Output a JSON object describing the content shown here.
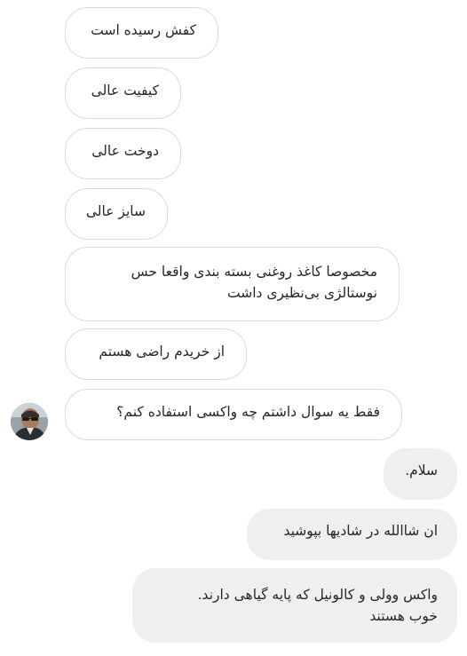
{
  "incoming_messages": [
    {
      "text": "کفش رسیده است"
    },
    {
      "text": "کیفیت عالی"
    },
    {
      "text": "دوخت عالی"
    },
    {
      "text": "سایز عالی"
    },
    {
      "line1": "مخصوصا کاغذ روغنی بسته بندی واقعا حس",
      "line2": "نوستالژی بی‌نظیری داشت"
    },
    {
      "text": "از خریدم راضی هستم"
    },
    {
      "text": "فقط یه سوال داشتم چه واکسی استفاده کنم؟"
    }
  ],
  "outgoing_messages": [
    {
      "text": "سلام."
    },
    {
      "text": "ان شاالله در شادیها بپوشید"
    },
    {
      "line1": "واکس وولی و کالونیل که پایه گیاهی دارند.",
      "line2": "خوب هستند"
    }
  ],
  "colors": {
    "incoming_bg": "#ffffff",
    "incoming_border": "#dbdbdb",
    "outgoing_bg": "#efefef",
    "text": "#262626"
  }
}
